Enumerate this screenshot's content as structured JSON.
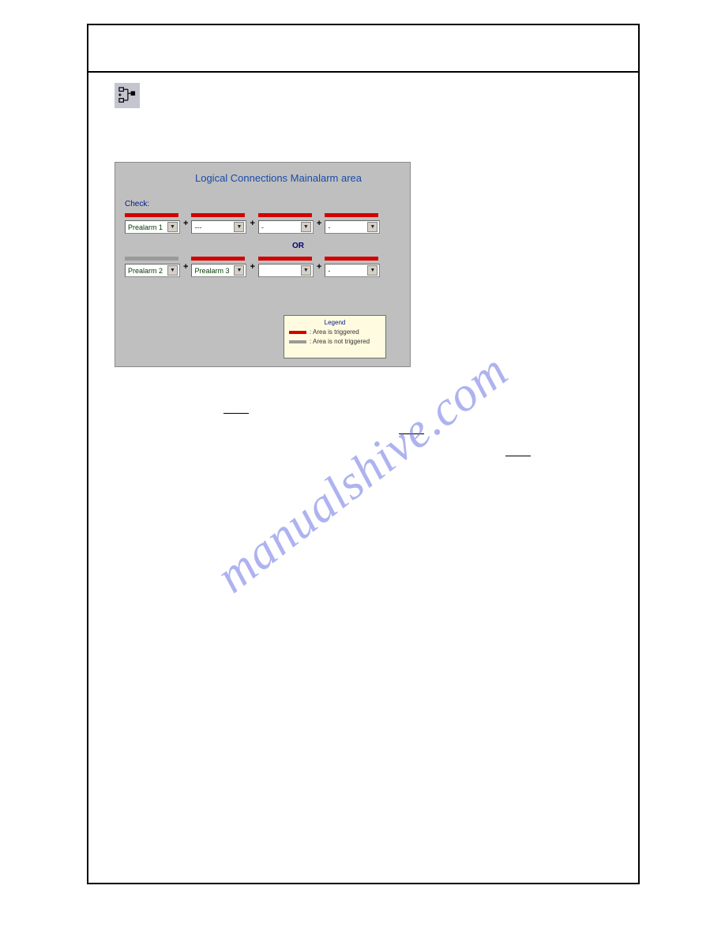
{
  "watermark": "manualshive.com",
  "panel": {
    "title": "Logical Connections Mainalarm area",
    "check_label": "Check:",
    "or_label": "OR",
    "row1": {
      "slot1": {
        "bar": "red",
        "value": "Prealarm 1"
      },
      "slot2": {
        "bar": "red",
        "value": "---"
      },
      "slot3": {
        "bar": "red",
        "value": "-"
      },
      "slot4": {
        "bar": "red",
        "value": "-"
      }
    },
    "row2": {
      "slot1": {
        "bar": "grey",
        "value": "Prealarm 2"
      },
      "slot2": {
        "bar": "red",
        "value": "Prealarm 3"
      },
      "slot3": {
        "bar": "red",
        "value": ""
      },
      "slot4": {
        "bar": "red",
        "value": "-"
      }
    },
    "legend": {
      "title": "Legend",
      "triggered": ": Area is triggered",
      "not_triggered": ": Area is not triggered"
    }
  },
  "plus": "+"
}
